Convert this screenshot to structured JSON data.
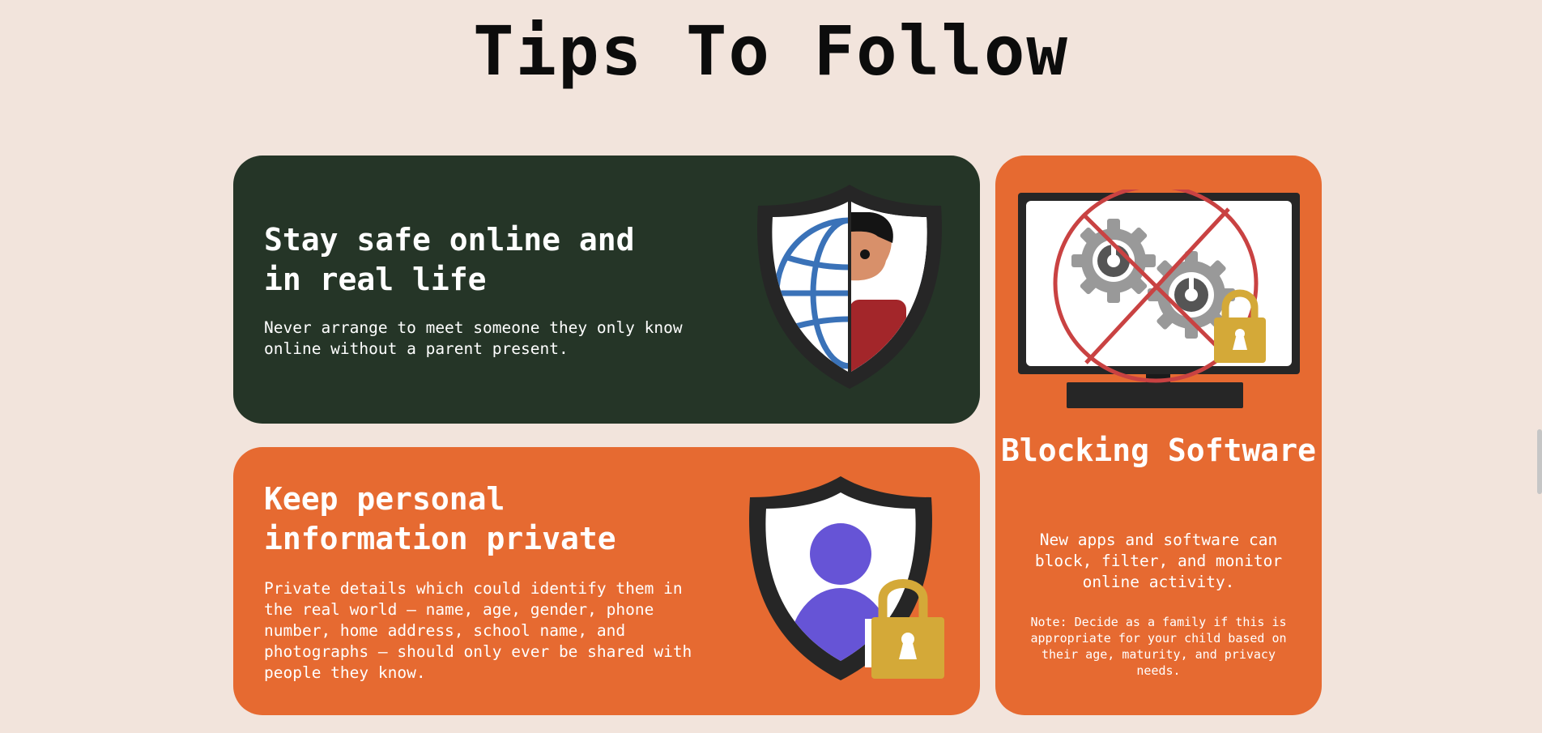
{
  "page": {
    "title": "Tips To Follow"
  },
  "cards": {
    "safe": {
      "title": "Stay safe online and in real life",
      "text": "Never arrange to meet someone they only know online without a parent present."
    },
    "private": {
      "title": "Keep personal information private",
      "text": "Private details which could identify them in the real world – name, age, gender, phone number, home address, school name, and photographs – should only ever be shared with people they know."
    },
    "blocking": {
      "title": "Blocking Software",
      "text": "New apps and software can block, filter, and monitor online activity.",
      "note": "Note: Decide as a family if this is appropriate for your child based on their age, maturity, and privacy needs."
    }
  },
  "icons": {
    "safe": "shield-globe-person-icon",
    "private": "shield-person-lock-icon",
    "blocking": "monitor-gears-blocked-icon"
  },
  "colors": {
    "background": "#f2e4dc",
    "dark_green": "#253527",
    "orange": "#e66a31",
    "lock_gold": "#d4a938",
    "avatar_purple": "#6654d6",
    "globe_blue": "#3a72b8",
    "block_red": "#c94242"
  }
}
